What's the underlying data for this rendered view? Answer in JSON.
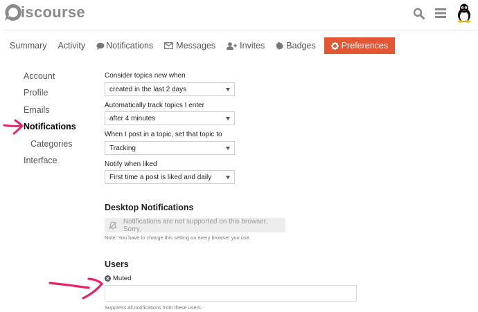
{
  "header": {
    "logo_text": "iscourse",
    "icons": [
      "search-icon",
      "hamburger-icon",
      "tux-avatar-icon"
    ]
  },
  "nav": {
    "tabs": [
      {
        "label": "Summary",
        "icon": ""
      },
      {
        "label": "Activity",
        "icon": ""
      },
      {
        "label": "Notifications",
        "icon": "speech-bubble-icon"
      },
      {
        "label": "Messages",
        "icon": "envelope-icon"
      },
      {
        "label": "Invites",
        "icon": "user-plus-icon"
      },
      {
        "label": "Badges",
        "icon": "badge-icon"
      },
      {
        "label": "Preferences",
        "icon": "gear-icon",
        "active": true
      }
    ]
  },
  "sidebar": {
    "items": [
      {
        "label": "Account"
      },
      {
        "label": "Profile"
      },
      {
        "label": "Emails"
      },
      {
        "label": "Notifications",
        "active": true
      },
      {
        "label": "Categories",
        "sub": true
      },
      {
        "label": "Interface"
      }
    ]
  },
  "form": {
    "new_topics": {
      "label": "Consider topics new when",
      "value": "created in the last 2 days"
    },
    "auto_track": {
      "label": "Automatically track topics I enter",
      "value": "after 4 minutes"
    },
    "when_post": {
      "label": "When I post in a topic, set that topic to",
      "value": "Tracking"
    },
    "notify_liked": {
      "label": "Notify when liked",
      "value": "First time a post is liked and daily"
    }
  },
  "desktop": {
    "title": "Desktop Notifications",
    "notice": "Notifications are not supported on this browser. Sorry.",
    "hint": "Note: You have to change this setting on every browser you use."
  },
  "users": {
    "title": "Users",
    "muted_label": "Muted",
    "hint": "Suppress all notifications from these users."
  },
  "colors": {
    "accent": "#e45735",
    "annotation": "#e8226e"
  }
}
